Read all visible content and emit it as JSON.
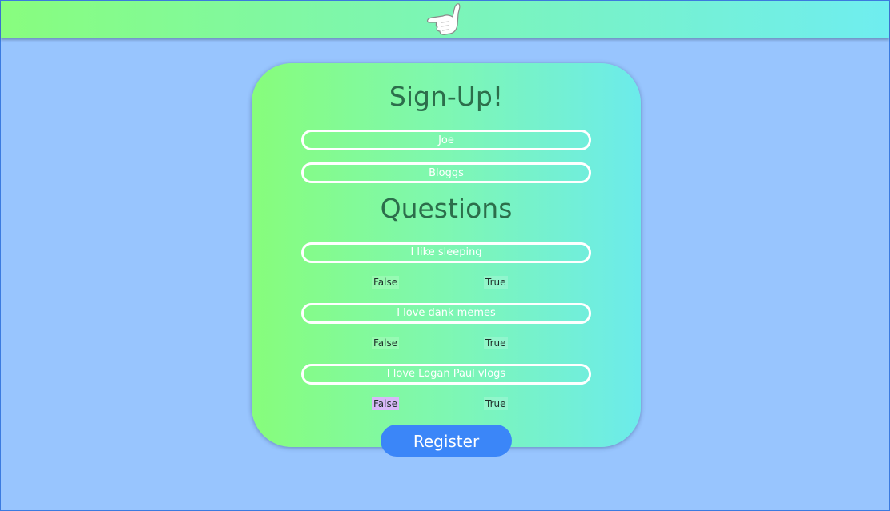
{
  "header": {
    "logo_icon": "hang-loose-hand-icon"
  },
  "signup": {
    "title": "Sign-Up!",
    "first_name": "Joe",
    "last_name": "Bloggs"
  },
  "questions": {
    "title": "Questions",
    "items": [
      {
        "label": "I like sleeping",
        "false_label": "False",
        "true_label": "True",
        "selected": ""
      },
      {
        "label": "I love dank memes",
        "false_label": "False",
        "true_label": "True",
        "selected": ""
      },
      {
        "label": "I love Logan Paul vlogs",
        "false_label": "False",
        "true_label": "True",
        "selected": "False"
      }
    ]
  },
  "register_label": "Register",
  "colors": {
    "background": "#98c5fe",
    "gradient_start": "#88fd7e",
    "gradient_end": "#6fedf0",
    "title_text": "#2c6e4b",
    "register_button": "#3b86f8",
    "selected_highlight": "#d8b8f8"
  }
}
